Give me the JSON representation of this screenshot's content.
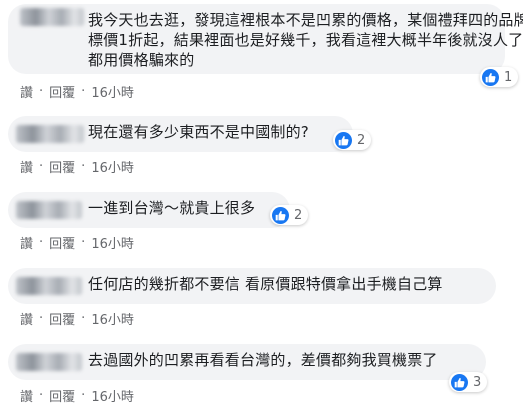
{
  "comments": [
    {
      "text": "我今天也去逛，發現這裡根本不是凹累的價格，某個禮拜四的品牌，標價1折起，結果裡面也是好幾千，我看這裡大概半年後就沒人了 ，都用價格騙來的",
      "reactions": "1",
      "like_label": "讚",
      "reply_label": "回覆",
      "time": "16小時"
    },
    {
      "text": "現在還有多少東西不是中國制的?",
      "reactions": "2",
      "like_label": "讚",
      "reply_label": "回覆",
      "time": "16小時"
    },
    {
      "text": "一進到台灣～就貴上很多",
      "reactions": "2",
      "like_label": "讚",
      "reply_label": "回覆",
      "time": "16小時"
    },
    {
      "text": "任何店的幾折都不要信 看原價跟特價拿出手機自己算",
      "reactions": "",
      "like_label": "讚",
      "reply_label": "回覆",
      "time": "16小時"
    },
    {
      "text": "去過國外的凹累再看看台灣的，差價都夠我買機票了",
      "reactions": "3",
      "like_label": "讚",
      "reply_label": "回覆",
      "time": "16小時"
    }
  ],
  "separator": "·",
  "colors": {
    "bubble": "#f2f3f5",
    "like_blue": "#1877f2",
    "meta": "#65676b"
  },
  "icons": {
    "reaction": "thumbs-up-icon"
  }
}
